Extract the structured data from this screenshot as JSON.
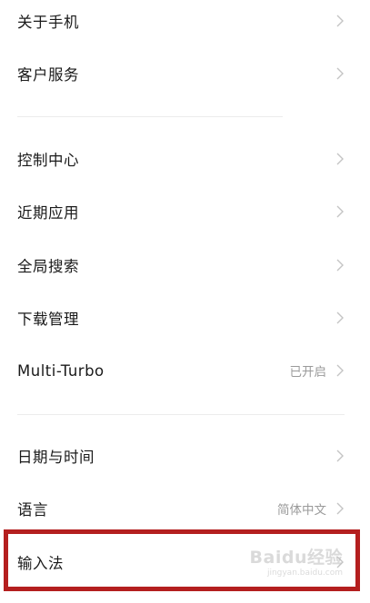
{
  "settings": {
    "group1": [
      {
        "label": "关于手机"
      },
      {
        "label": "客户服务"
      }
    ],
    "group2": [
      {
        "label": "控制中心"
      },
      {
        "label": "近期应用"
      },
      {
        "label": "全局搜索"
      },
      {
        "label": "下载管理"
      },
      {
        "label": "Multi-Turbo",
        "value": "已开启"
      }
    ],
    "group3": [
      {
        "label": "日期与时间"
      },
      {
        "label": "语言",
        "value": "简体中文"
      },
      {
        "label": "输入法"
      }
    ]
  },
  "watermark": {
    "logo": "Baidu经验",
    "sub": "jingyan.baidu.com"
  },
  "icons": {
    "chevron": "chevron-right-icon"
  },
  "colors": {
    "highlight": "#b41f1f",
    "value_text": "#9a9a9a"
  }
}
